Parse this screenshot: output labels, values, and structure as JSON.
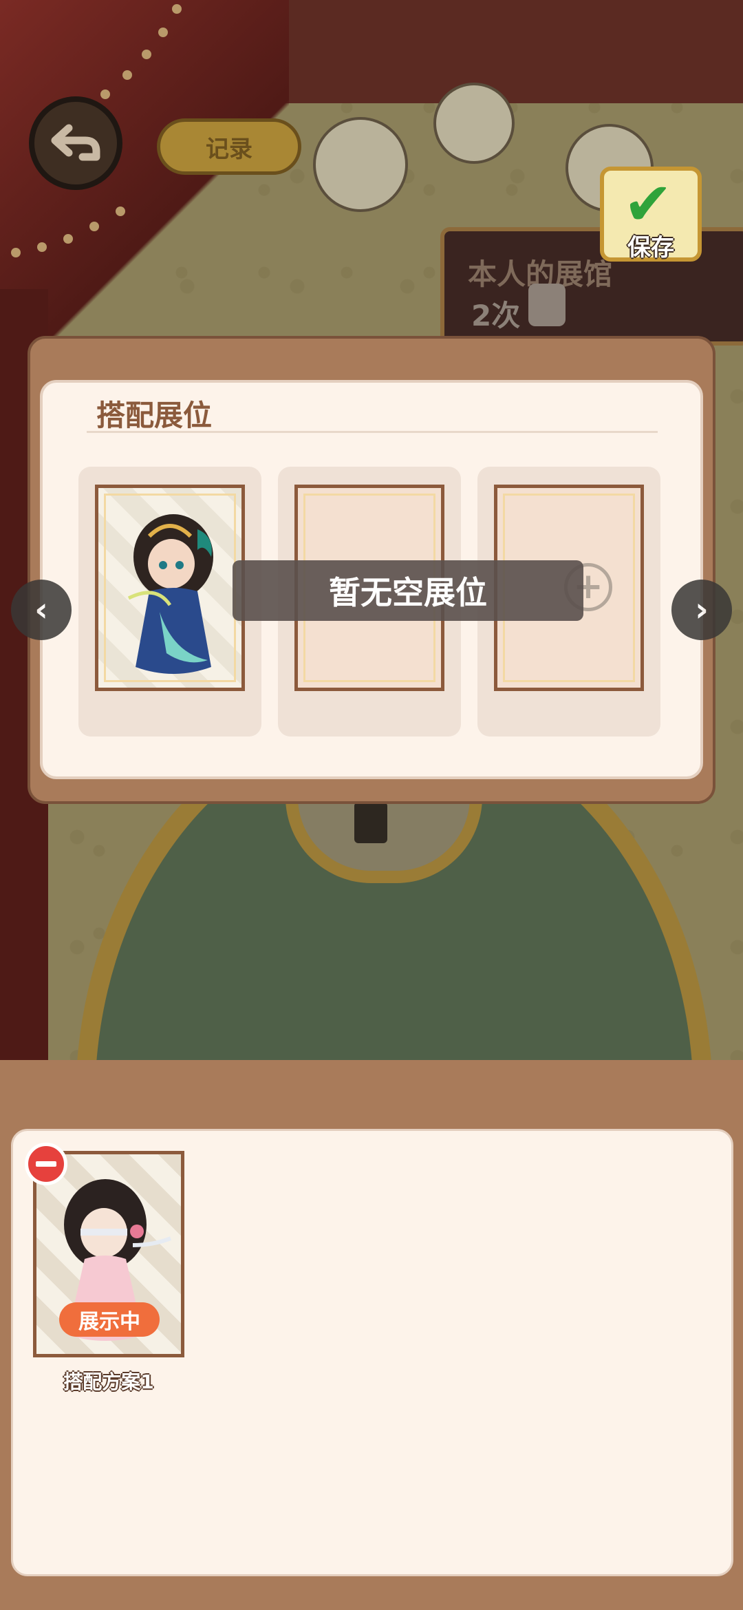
{
  "header": {
    "record_label": "记录",
    "save_label": "保存"
  },
  "sign": {
    "title": "本人的展馆",
    "count": "2次"
  },
  "slots": {
    "title": "搭配展位",
    "toast": "暂无空展位",
    "items": [
      {
        "state": "filled"
      },
      {
        "state": "empty"
      },
      {
        "state": "add"
      }
    ]
  },
  "schemes": {
    "items": [
      {
        "name": "搭配方案1",
        "badge": "展示中"
      }
    ]
  },
  "colors": {
    "panel": "#a97b5a",
    "inner": "#fdf3ea",
    "badge": "#f06e3c",
    "remove": "#e6413d",
    "check": "#2fa33a"
  }
}
